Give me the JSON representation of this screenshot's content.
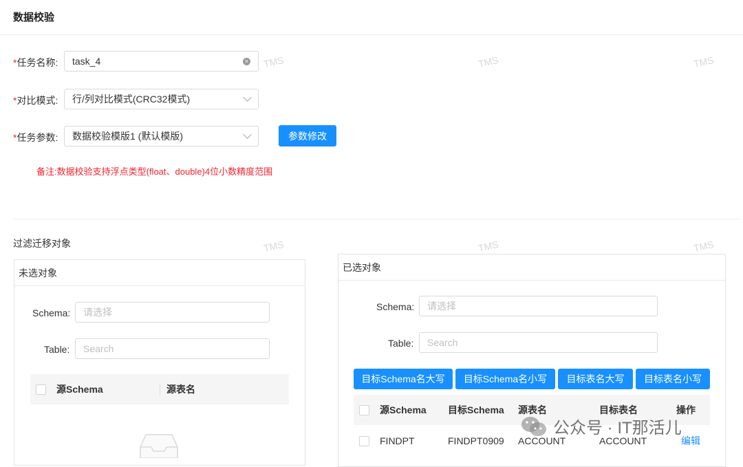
{
  "page": {
    "title": "数据校验"
  },
  "form": {
    "task_name": {
      "label": "任务名称:",
      "value": "task_4"
    },
    "compare_mode": {
      "label": "对比模式:",
      "value": "行/列对比模式(CRC32模式)"
    },
    "task_params": {
      "label": "任务参数:",
      "value": "数据校验模版1 (默认模版)"
    },
    "required_mark": "*",
    "modify_params_label": "参数修改",
    "note": "备注:数据校验支持浮点类型(float、double)4位小数精度范围"
  },
  "filter": {
    "title": "过滤迁移对象",
    "unselected": {
      "title": "未选对象",
      "schema_label": "Schema:",
      "schema_placeholder": "请选择",
      "table_label": "Table:",
      "table_placeholder": "Search",
      "columns": [
        "源Schema",
        "源表名"
      ]
    },
    "selected": {
      "title": "已选对象",
      "schema_label": "Schema:",
      "schema_placeholder": "请选择",
      "table_label": "Table:",
      "table_placeholder": "Search",
      "buttons": [
        "目标Schema名大写",
        "目标Schema名小写",
        "目标表名大写",
        "目标表名小写"
      ],
      "columns": [
        "源Schema",
        "目标Schema",
        "源表名",
        "目标表名",
        "操作"
      ],
      "rows": [
        {
          "src_schema": "FINDPT",
          "target_schema": "FINDPT0909",
          "src_table": "ACCOUNT",
          "target_table": "ACCOUNT",
          "action": "编辑"
        }
      ]
    }
  },
  "watermark": {
    "text": "TMS",
    "source": "公众号 · IT那活儿"
  },
  "colors": {
    "primary": "#1890ff",
    "danger": "#f5222d"
  }
}
